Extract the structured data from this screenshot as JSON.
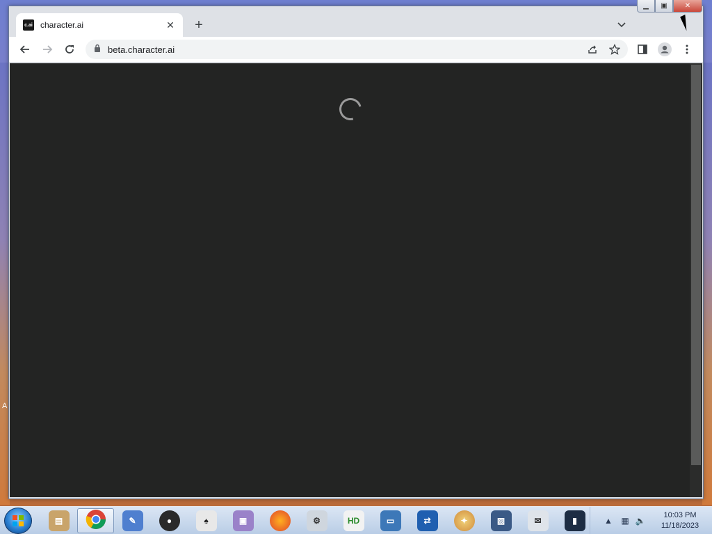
{
  "browser": {
    "tab": {
      "title": "character.ai",
      "favicon_text": "c.ai"
    },
    "address_bar": {
      "url": "beta.character.ai"
    },
    "toolbar_icons": [
      "back-icon",
      "forward-icon",
      "reload-icon",
      "lock-icon",
      "share-icon",
      "star-icon",
      "side-panel-icon",
      "profile-icon",
      "menu-icon"
    ]
  },
  "page": {
    "state": "loading",
    "background_color": "#232423"
  },
  "taskbar": {
    "apps": [
      "explorer-icon",
      "chrome-icon",
      "app-icon",
      "app-icon",
      "solitaire-icon",
      "app-icon",
      "firefox-icon",
      "app-icon",
      "hxd-icon",
      "app-icon",
      "remote-desktop-icon",
      "paint-icon",
      "photo-icon",
      "app-icon",
      "device-icon"
    ],
    "clock_time": "10:03 PM",
    "clock_date": "11/18/2023"
  },
  "desktop": {
    "edge_letter": "A"
  }
}
